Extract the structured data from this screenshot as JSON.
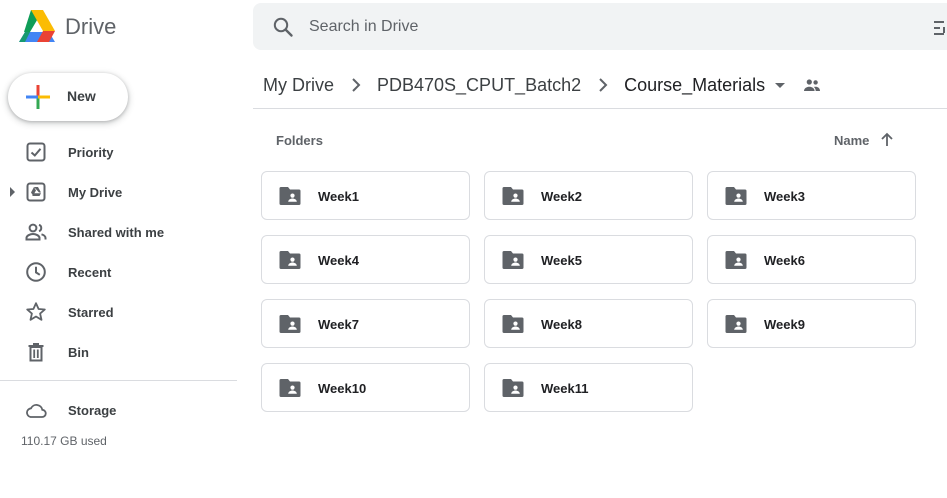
{
  "app": {
    "brand": "Drive"
  },
  "search": {
    "placeholder": "Search in Drive"
  },
  "sidebar": {
    "new_label": "New",
    "items": [
      {
        "label": "Priority",
        "icon": "priority-icon"
      },
      {
        "label": "My Drive",
        "icon": "my-drive-icon"
      },
      {
        "label": "Shared with me",
        "icon": "shared-with-me-icon"
      },
      {
        "label": "Recent",
        "icon": "clock-icon"
      },
      {
        "label": "Starred",
        "icon": "star-icon"
      },
      {
        "label": "Bin",
        "icon": "bin-icon"
      }
    ],
    "storage": {
      "label": "Storage",
      "used": "110.17 GB used"
    }
  },
  "breadcrumb": [
    "My Drive",
    "PDB470S_CPUT_Batch2",
    "Course_Materials"
  ],
  "main": {
    "section_title": "Folders",
    "sort_label": "Name",
    "folders": [
      "Week1",
      "Week2",
      "Week3",
      "Week4",
      "Week5",
      "Week6",
      "Week7",
      "Week8",
      "Week9",
      "Week10",
      "Week11"
    ]
  },
  "colors": {
    "icon_gray": "#5f6368",
    "border": "#dadce0",
    "search_bg": "#f1f3f4"
  }
}
